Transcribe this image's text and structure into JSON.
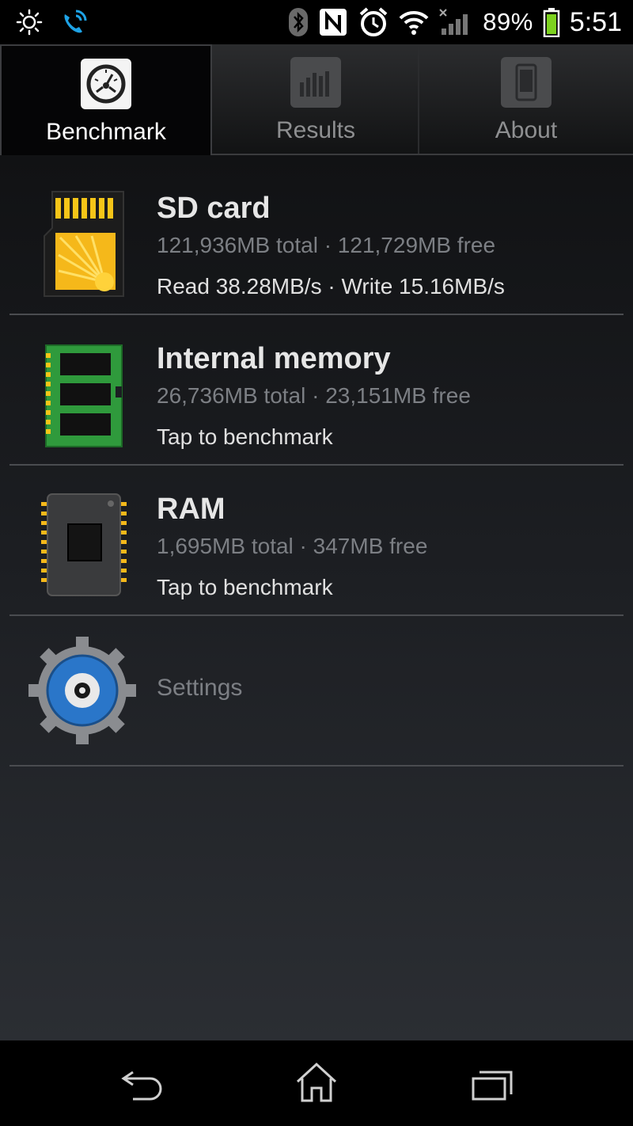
{
  "status_bar": {
    "battery_percent": "89%",
    "time": "5:51",
    "icons_left": [
      "brightness-icon",
      "wifi-calling-icon"
    ],
    "icons_right": [
      "bluetooth-icon",
      "nfc-icon",
      "alarm-icon",
      "wifi-icon",
      "signal-icon",
      "battery-icon"
    ]
  },
  "tabs": [
    {
      "label": "Benchmark",
      "icon": "speedometer-icon",
      "active": true
    },
    {
      "label": "Results",
      "icon": "bar-chart-icon",
      "active": false
    },
    {
      "label": "About",
      "icon": "phone-icon",
      "active": false
    }
  ],
  "items": [
    {
      "title": "SD card",
      "subtitle": "121,936MB total · 121,729MB free",
      "status": "Read 38.28MB/s · Write 15.16MB/s",
      "icon": "sd-card-icon"
    },
    {
      "title": "Internal memory",
      "subtitle": "26,736MB total · 23,151MB free",
      "status": "Tap to benchmark",
      "icon": "memory-module-icon"
    },
    {
      "title": "RAM",
      "subtitle": "1,695MB total · 347MB free",
      "status": "Tap to benchmark",
      "icon": "ram-chip-icon"
    }
  ],
  "settings": {
    "label": "Settings",
    "icon": "gear-icon"
  },
  "nav": [
    "back-icon",
    "home-icon",
    "recent-apps-icon"
  ],
  "colors": {
    "accent_yellow": "#f5c518",
    "battery_green": "#7dd21f",
    "pcb_green": "#2f9a3c",
    "gear_blue": "#2a76c9"
  }
}
